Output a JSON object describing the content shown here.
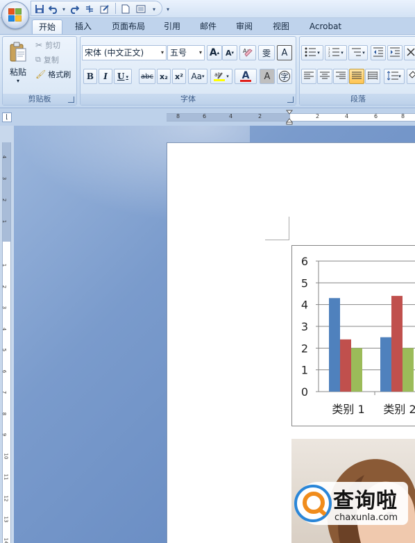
{
  "quick_access": {
    "icons": [
      "save-icon",
      "undo-icon",
      "redo-icon",
      "draw-table-icon",
      "edit-icon",
      "new-document-icon",
      "print-layout-icon"
    ]
  },
  "tabs": [
    {
      "label": "开始",
      "active": true
    },
    {
      "label": "插入",
      "active": false
    },
    {
      "label": "页面布局",
      "active": false
    },
    {
      "label": "引用",
      "active": false
    },
    {
      "label": "邮件",
      "active": false
    },
    {
      "label": "审阅",
      "active": false
    },
    {
      "label": "视图",
      "active": false
    },
    {
      "label": "Acrobat",
      "active": false
    }
  ],
  "clipboard": {
    "paste": "粘贴",
    "cut": "剪切",
    "copy": "复制",
    "format_painter": "格式刷",
    "group_label": "剪贴板"
  },
  "font": {
    "font_name": "宋体 (中文正文)",
    "font_size": "五号",
    "grow": "A",
    "shrink": "A",
    "bold": "B",
    "italic": "I",
    "underline": "U",
    "strike": "abc",
    "subscript": "x₂",
    "superscript": "x²",
    "change_case": "Aa",
    "font_color": "A",
    "char_shading": "A",
    "enclose": "字",
    "phonetic": "雯",
    "border": "A",
    "group_label": "字体"
  },
  "paragraph": {
    "group_label": "段落"
  },
  "ruler": {
    "h_numbers": [
      "8",
      "6",
      "4",
      "2",
      "2",
      "4",
      "6",
      "8"
    ],
    "v_numbers": [
      "4",
      "3",
      "2",
      "1",
      "1",
      "2",
      "3",
      "4",
      "5",
      "6",
      "7",
      "8",
      "9",
      "10",
      "11",
      "12",
      "13",
      "14"
    ]
  },
  "chart_data": {
    "type": "bar",
    "categories": [
      "类别 1",
      "类别 2"
    ],
    "series": [
      {
        "values": [
          4.3,
          2.5
        ],
        "color": "#4f81bd"
      },
      {
        "values": [
          2.4,
          4.4
        ],
        "color": "#c0504d"
      },
      {
        "values": [
          2.0,
          2.0
        ],
        "color": "#9bbb59"
      }
    ],
    "ylim": [
      0,
      6
    ],
    "yticks": [
      "0",
      "1",
      "2",
      "3",
      "4",
      "5",
      "6"
    ],
    "grid": true
  },
  "watermark": {
    "title": "查询啦",
    "domain": "chaxunla.com"
  }
}
